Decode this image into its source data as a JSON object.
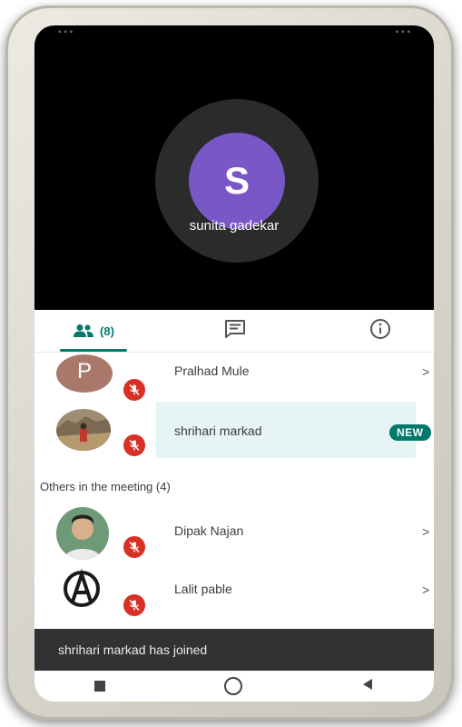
{
  "speaker": {
    "initial": "S",
    "name": "sunita gadekar"
  },
  "tabs": {
    "people_count": "(8)",
    "people_icon": "people-icon",
    "chat_icon": "chat-icon",
    "info_icon": "info-icon"
  },
  "participants": [
    {
      "name": "Pralhad Mule",
      "initial": "P",
      "chevron": ">"
    },
    {
      "name": "shrihari markad",
      "badge": "NEW"
    }
  ],
  "others": {
    "header": "Others in the meeting (4)",
    "items": [
      {
        "name": "Dipak Najan",
        "chevron": ">"
      },
      {
        "name": "Lalit pable",
        "chevron": ">"
      }
    ]
  },
  "snackbar": {
    "message": "shrihari markad has joined"
  },
  "colors": {
    "accent": "#00796b",
    "avatar": "#7a57c6",
    "mute": "#d93025"
  }
}
